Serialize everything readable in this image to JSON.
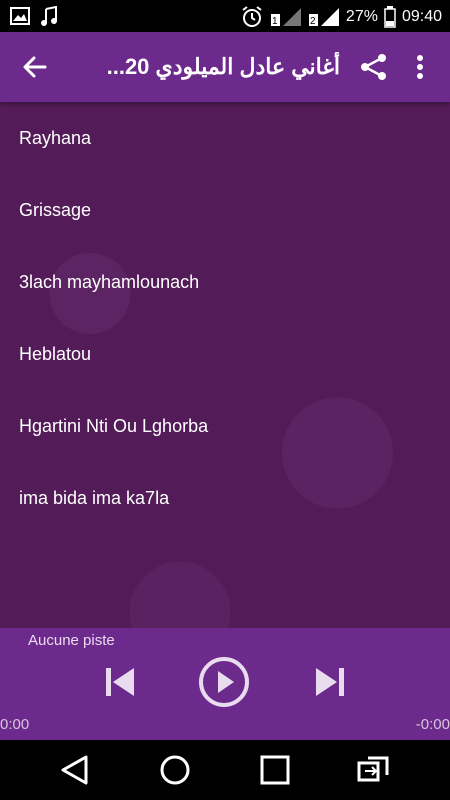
{
  "status_bar": {
    "battery_percent": "27%",
    "time": "09:40",
    "icons": [
      "image-icon",
      "music-note-icon",
      "alarm-icon",
      "signal-sim1-icon",
      "signal-sim2-icon",
      "battery-icon"
    ]
  },
  "app_bar": {
    "title": "أغاني عادل الميلودي 20...",
    "back_icon": "back-arrow-icon",
    "share_icon": "share-icon",
    "more_icon": "more-vert-icon"
  },
  "tracks": [
    "Rayhana",
    "Grissage",
    "3lach mayhamlounach",
    "Heblatou",
    "Hgartini Nti Ou Lghorba",
    "ima bida ima ka7la"
  ],
  "player": {
    "now_playing": "Aucune piste",
    "elapsed": "0:00",
    "remaining": "-0:00",
    "progress": 0,
    "controls": [
      "skip-previous-icon",
      "play-icon",
      "skip-next-icon"
    ]
  },
  "navigation_bar": {
    "icons": [
      "nav-back-icon",
      "nav-home-icon",
      "nav-recents-icon",
      "nav-switch-icon"
    ]
  },
  "colors": {
    "app_bar": "#6d2a8d",
    "background": "#531c58",
    "player": "#6c2a8c",
    "text": "#ffffff"
  }
}
